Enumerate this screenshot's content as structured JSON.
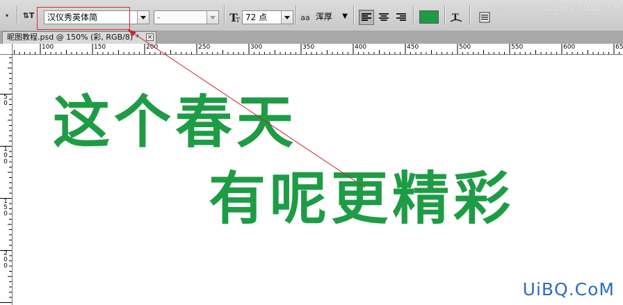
{
  "toolbar": {
    "font_family": "汉仪秀英体简",
    "font_style": "-",
    "font_size": "72 点",
    "anti_alias": "浑厚",
    "text_color": "#1e9c45",
    "aa_icon_text": "aa"
  },
  "watermark_top": "思缘设计论坛 www.MISSYUAN.COM",
  "document_tab": {
    "title": "昵图教程.psd @ 150% (彩, RGB/8) *",
    "close": "×"
  },
  "ruler_top": {
    "labels": [
      "100",
      "150",
      "200",
      "250",
      "300",
      "350",
      "400",
      "450",
      "500",
      "550",
      "600",
      "65"
    ]
  },
  "ruler_left": {
    "labels": [
      [
        "5",
        "0"
      ],
      [
        "1",
        "0",
        "0"
      ],
      [
        "1",
        "5",
        "0"
      ],
      [
        "2",
        "0",
        "0"
      ]
    ]
  },
  "canvas": {
    "line1": "这个春天",
    "line2": "有呢更精彩"
  },
  "watermark_bottom": "UiBQ.CoM",
  "colors": {
    "highlight_box": "#e0262e",
    "arrow": "#c0282e",
    "text_green": "#1e9c45"
  }
}
